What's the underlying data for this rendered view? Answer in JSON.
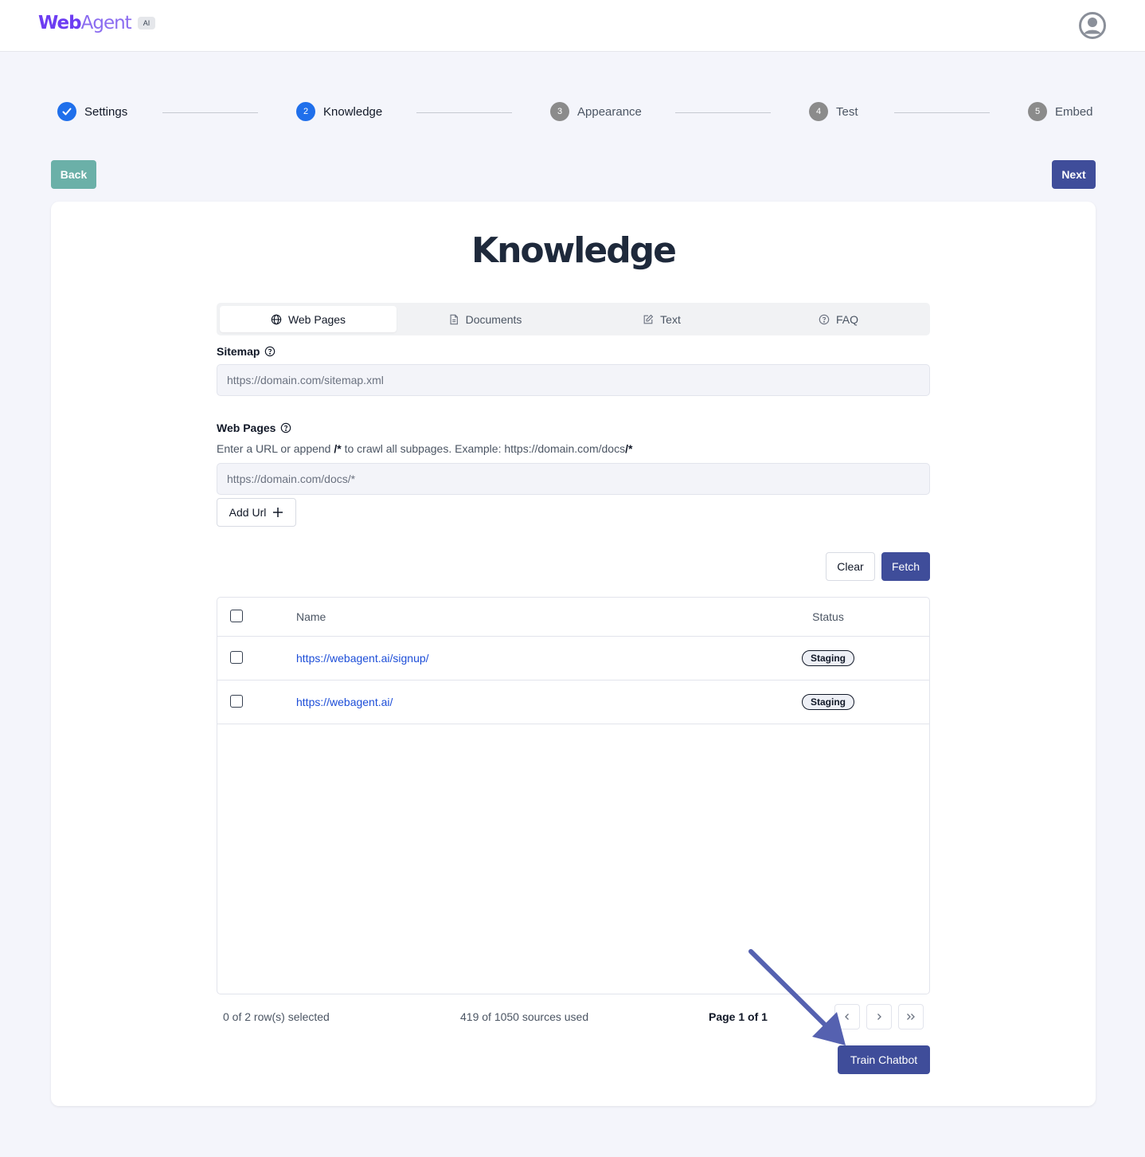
{
  "brand": {
    "name_part1": "Web",
    "name_part2": "Agent",
    "badge": "AI"
  },
  "stepper": {
    "steps": [
      {
        "label": "Settings",
        "number": "1",
        "state": "done"
      },
      {
        "label": "Knowledge",
        "number": "2",
        "state": "current"
      },
      {
        "label": "Appearance",
        "number": "3",
        "state": "todo"
      },
      {
        "label": "Test",
        "number": "4",
        "state": "todo"
      },
      {
        "label": "Embed",
        "number": "5",
        "state": "todo"
      }
    ]
  },
  "nav": {
    "back_label": "Back",
    "next_label": "Next"
  },
  "page": {
    "title": "Knowledge"
  },
  "tabs": [
    {
      "label": "Web Pages",
      "icon": "globe-icon",
      "active": true
    },
    {
      "label": "Documents",
      "icon": "document-icon",
      "active": false
    },
    {
      "label": "Text",
      "icon": "edit-icon",
      "active": false
    },
    {
      "label": "FAQ",
      "icon": "help-circle-icon",
      "active": false
    }
  ],
  "sitemap": {
    "label": "Sitemap",
    "placeholder": "https://domain.com/sitemap.xml"
  },
  "webpages": {
    "label": "Web Pages",
    "hint_part1": "Enter a URL or append ",
    "hint_bold1": "/*",
    "hint_part2": " to crawl all subpages. Example: https://domain.com/docs",
    "hint_bold2": "/*",
    "placeholder": "https://domain.com/docs/*",
    "add_label": "Add Url"
  },
  "actions": {
    "clear_label": "Clear",
    "fetch_label": "Fetch",
    "train_label": "Train Chatbot"
  },
  "table": {
    "headers": {
      "name": "Name",
      "status": "Status"
    },
    "rows": [
      {
        "name": "https://webagent.ai/signup/",
        "status": "Staging"
      },
      {
        "name": "https://webagent.ai/",
        "status": "Staging"
      }
    ]
  },
  "footer": {
    "selected": "0 of 2 row(s) selected",
    "sources": "419 of 1050 sources used",
    "page_info": "Page 1 of 1"
  },
  "colors": {
    "primary": "#3f4d9a",
    "back": "#6bb0a8",
    "step_active": "#1f6feb",
    "link": "#1d4ed8",
    "arrow": "#5561b0"
  }
}
